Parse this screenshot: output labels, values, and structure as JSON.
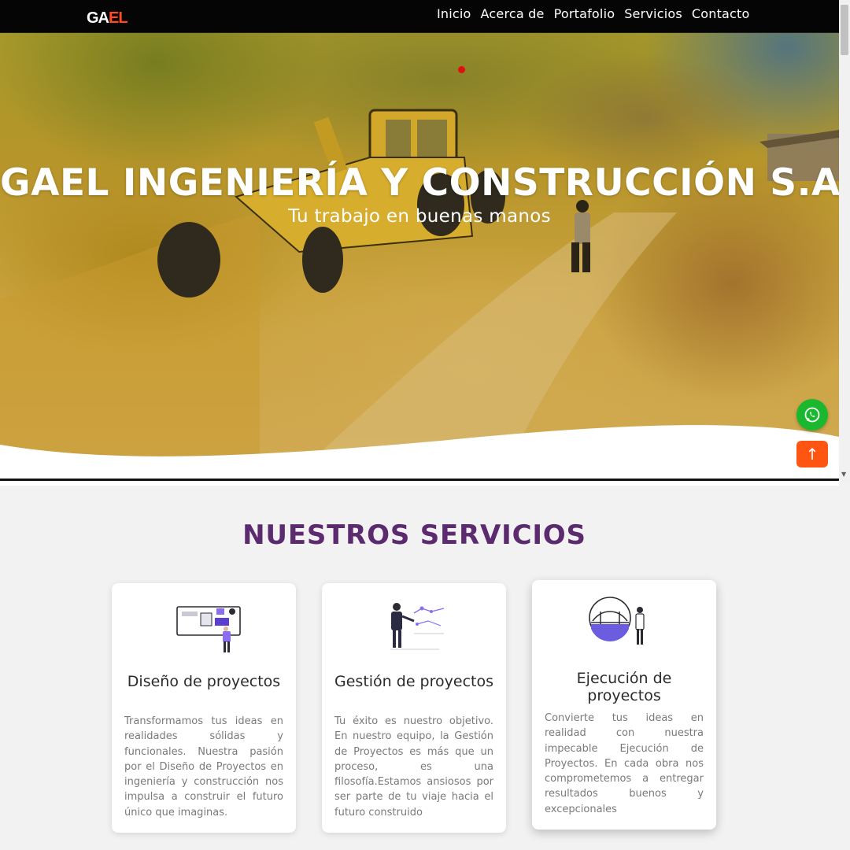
{
  "navbar": {
    "logo_part1": "GA",
    "logo_part2": "EL",
    "links": [
      "Inicio",
      "Acerca de",
      "Portafolio",
      "Servicios",
      "Contacto"
    ]
  },
  "hero": {
    "title": "GAEL INGENIERÍA Y CONSTRUCCIÓN S.A.C",
    "subtitle": "Tu trabajo en buenas manos"
  },
  "floating": {
    "whatsapp_icon": "whatsapp-icon",
    "back_to_top": "↑"
  },
  "services": {
    "heading": "NUESTROS SERVICIOS",
    "cards": [
      {
        "title": "Diseño de proyectos",
        "text": "Transformamos tus ideas en realidades sólidas y funcionales. Nuestra pasión por el Diseño de Proyectos en ingeniería y construcción nos impulsa a construir el futuro único que imaginas."
      },
      {
        "title": "Gestión de proyectos",
        "text": "Tu éxito es nuestro objetivo. En nuestro equipo, la Gestión de Proyectos es más que un proceso, es una filosofía.Estamos ansiosos por ser parte de tu viaje hacia el futuro construido"
      },
      {
        "title": "Ejecución de proyectos",
        "text": "Convierte tus ideas en realidad con nuestra impecable Ejecución de Proyectos. En cada obra nos comprometemos a entregar resultados buenos y excepcionales"
      }
    ]
  },
  "colors": {
    "nav_bg": "#050505",
    "logo_accent": "#ff4b1f",
    "heading": "#5c2a6e",
    "whatsapp": "#19b82e",
    "top_button": "#ff5512"
  }
}
